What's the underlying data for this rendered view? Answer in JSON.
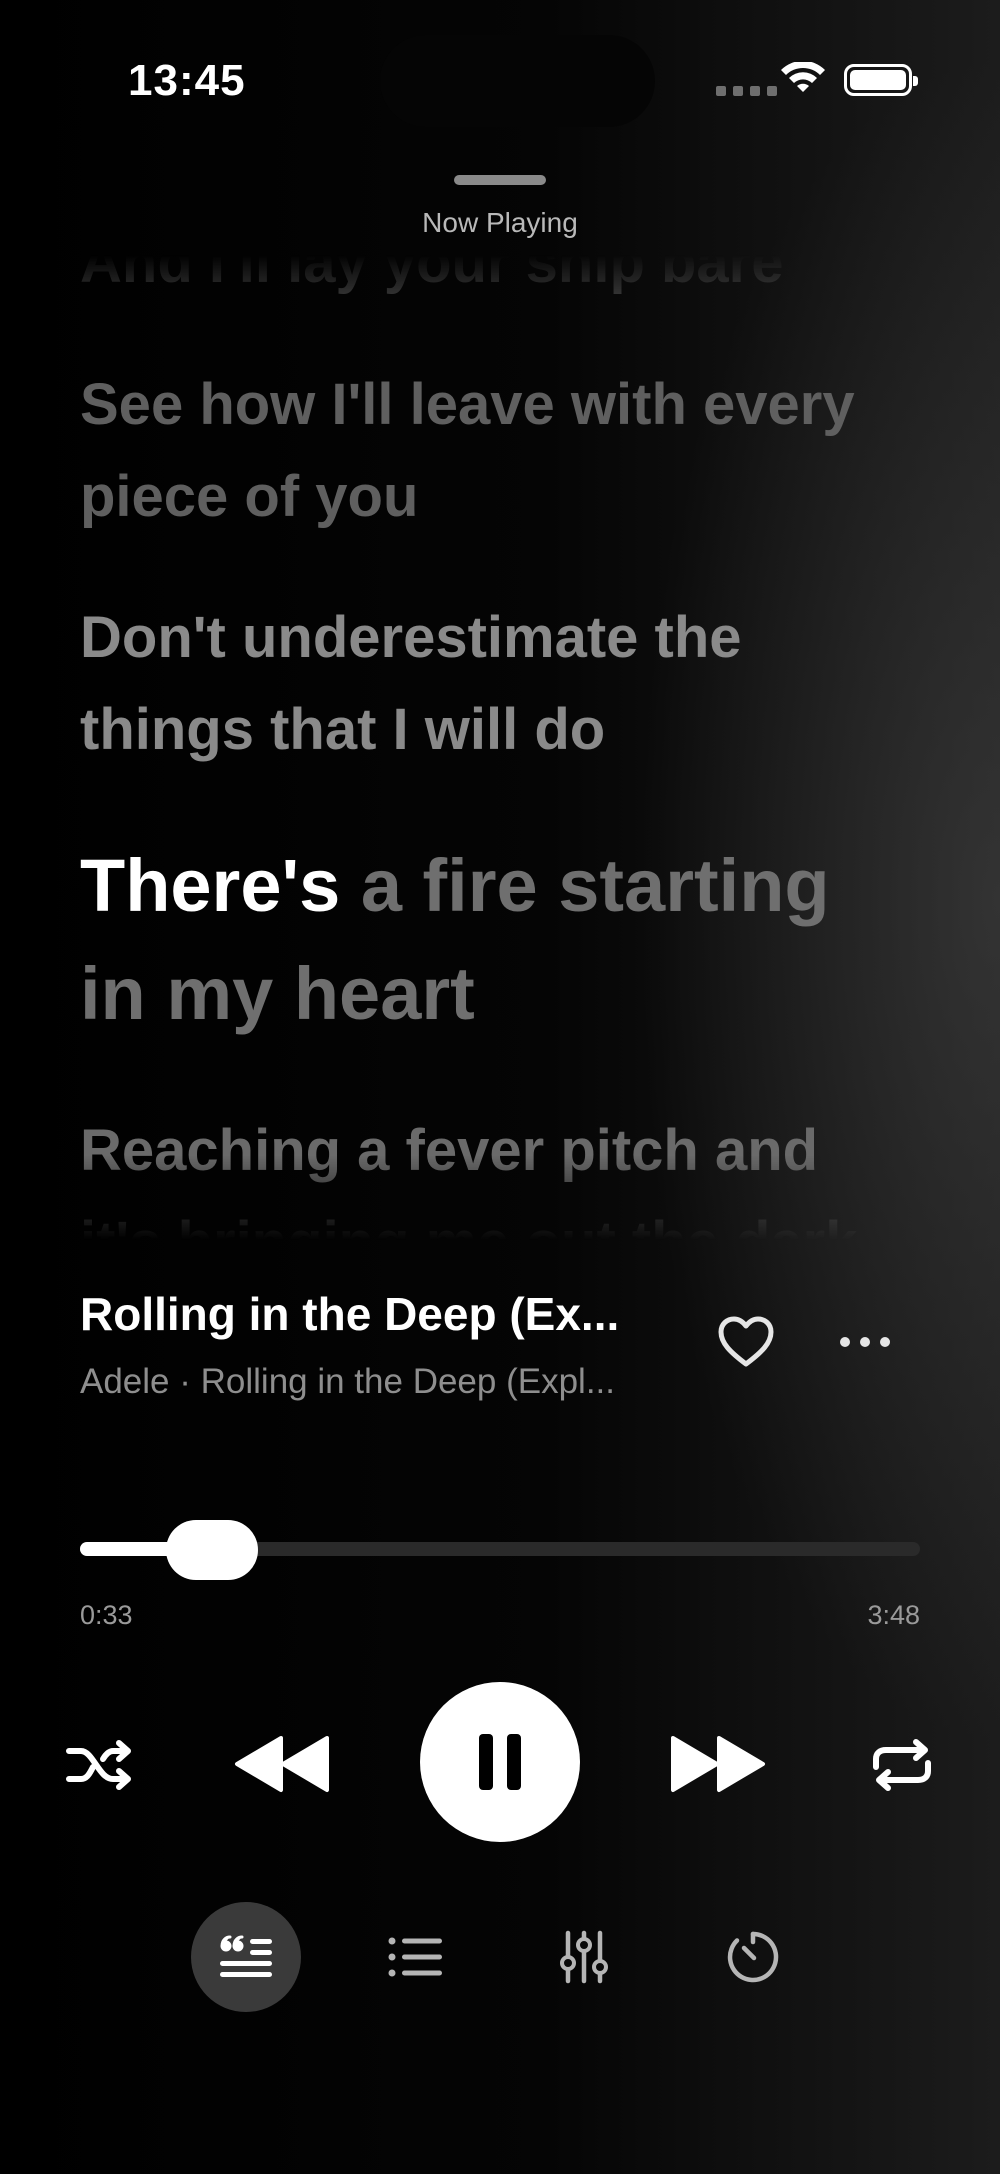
{
  "status_bar": {
    "time": "13:45"
  },
  "sheet": {
    "title": "Now Playing"
  },
  "lyrics": {
    "lines": [
      "And I'll lay your ship bare",
      "See how I'll leave with every piece of you",
      "Don't underestimate the things that I will do",
      "There's a fire starting in my heart",
      "Reaching a fever pitch and it's bringing me out the dark"
    ],
    "current_sung": "There's",
    "current_rest": " a fire starting in my heart"
  },
  "track": {
    "title": "Rolling in the Deep (Ex...",
    "subtitle": "Adele · Rolling in the Deep (Expl..."
  },
  "progress": {
    "elapsed": "0:33",
    "total": "3:48",
    "fraction": 0.145
  },
  "icons": {
    "heart": "heart-icon",
    "more": "more-horizontal-icon",
    "shuffle": "shuffle-icon",
    "previous": "previous-icon",
    "pause": "pause-icon",
    "next": "next-icon",
    "repeat": "repeat-icon",
    "lyrics": "lyrics-icon",
    "queue": "queue-list-icon",
    "equalizer": "equalizer-icon",
    "timer": "sleep-timer-icon"
  },
  "colors": {
    "accent": "#ffffff",
    "inactive_lyric": "#6b6b6b",
    "background": "#000000"
  }
}
